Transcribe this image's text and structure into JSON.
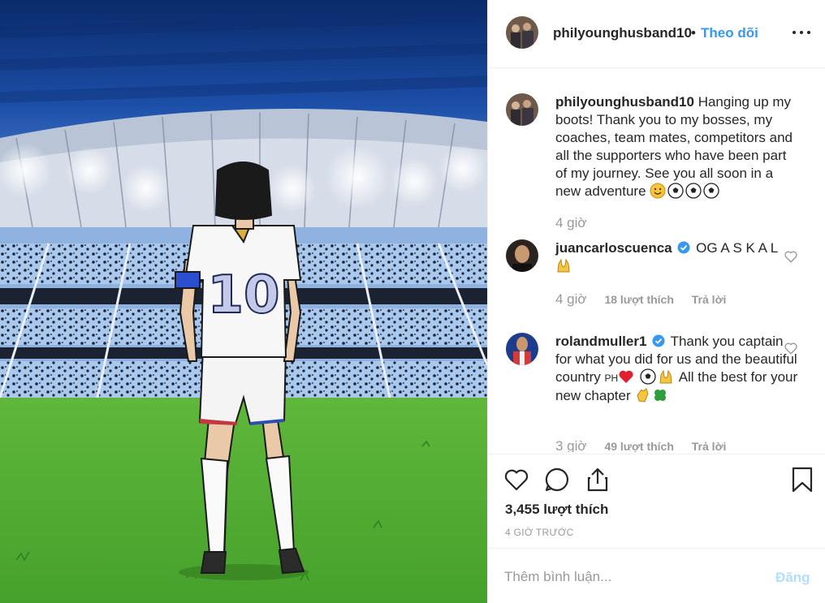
{
  "header": {
    "username": "philyounghusband10",
    "separator": "•",
    "follow_label": "Theo dõi"
  },
  "caption": {
    "username": "philyounghusband10",
    "text": "Hanging up my boots! Thank you to my bosses, my coaches, team mates, competitors and all the supporters who have been part of my journey. See you all soon in a new adventure",
    "time": "4 giờ"
  },
  "comments": [
    {
      "username": "juancarloscuenca",
      "verified": true,
      "text": "OG A S K A L",
      "time": "4 giờ",
      "likes": "18 lượt thích",
      "reply": "Trả lời"
    },
    {
      "username": "rolandmuller1",
      "verified": true,
      "text_1": "Thank you captain for what you did for us and the beautiful country",
      "ph": "PH",
      "text_2": "All the best for your new chapter",
      "time": "3 giờ",
      "likes": "49 lượt thích",
      "reply": "Trả lời"
    }
  ],
  "actions": {
    "likes_count": "3,455 lượt thích",
    "time_ago": "4 GIỜ TRƯỚC"
  },
  "add_comment": {
    "placeholder": "Thêm bình luận...",
    "post_label": "Đăng"
  },
  "colors": {
    "link_blue": "#3897f0",
    "post_disabled": "#b2dffc",
    "muted": "#999999",
    "border": "#efefef"
  },
  "icons": {
    "heart": "heart-icon",
    "comment": "comment-icon",
    "share": "share-icon",
    "save": "bookmark-icon",
    "more": "more-options-icon",
    "verified": "verified-badge-icon"
  }
}
